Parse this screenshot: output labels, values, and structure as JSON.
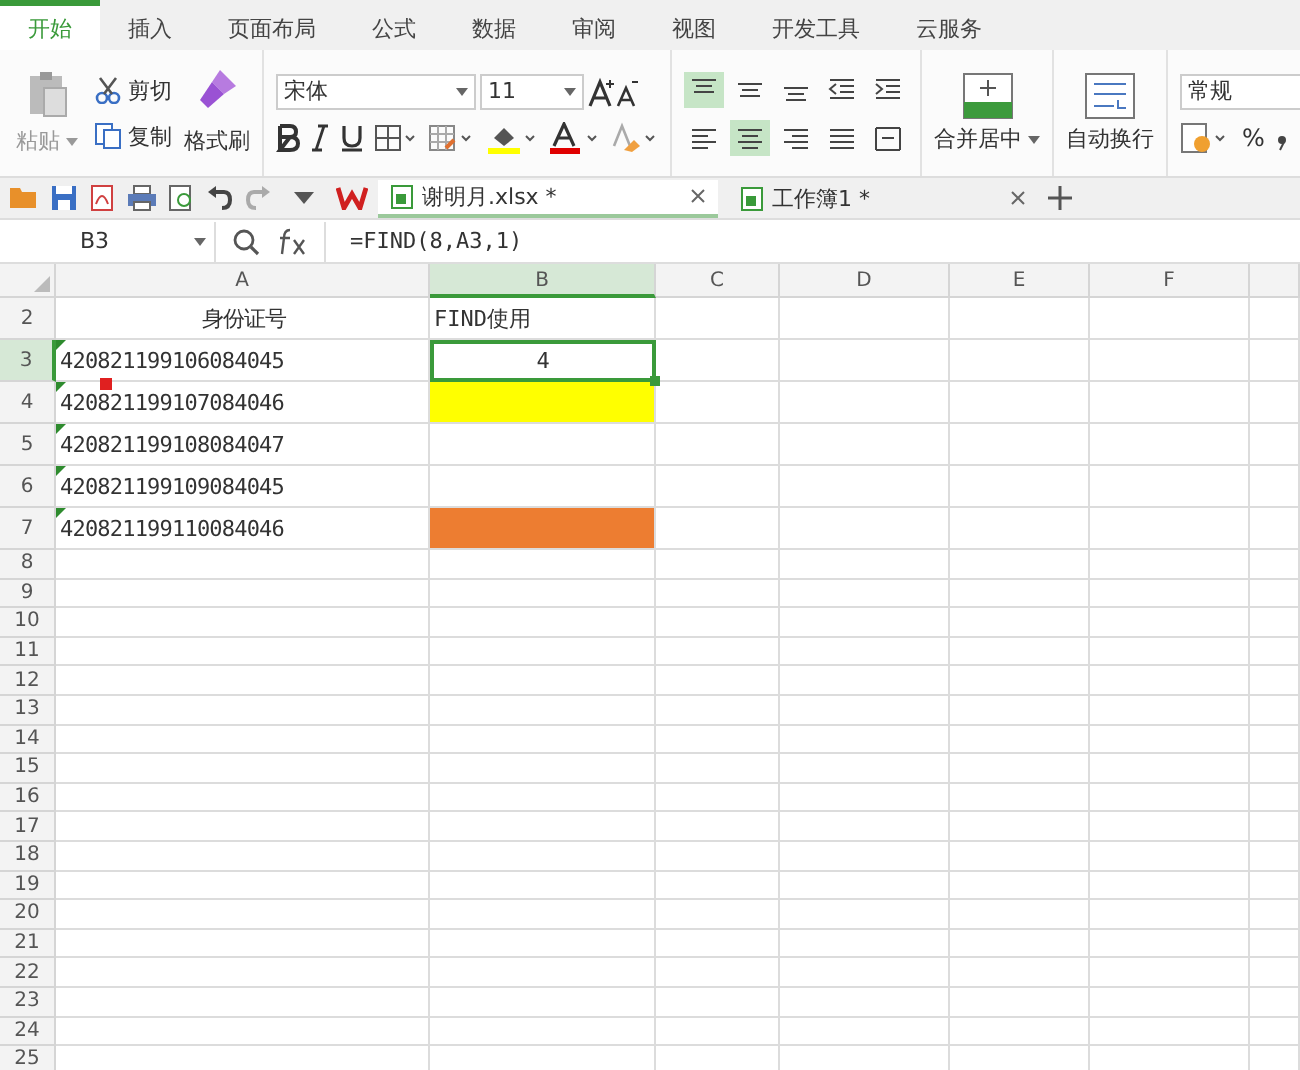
{
  "menu_tabs": [
    {
      "label": "开始",
      "selected": true
    },
    {
      "label": "插入",
      "selected": false
    },
    {
      "label": "页面布局",
      "selected": false
    },
    {
      "label": "公式",
      "selected": false
    },
    {
      "label": "数据",
      "selected": false
    },
    {
      "label": "审阅",
      "selected": false
    },
    {
      "label": "视图",
      "selected": false
    },
    {
      "label": "开发工具",
      "selected": false
    },
    {
      "label": "云服务",
      "selected": false
    }
  ],
  "clipboard": {
    "paste": "粘贴",
    "cut": "剪切",
    "copy": "复制",
    "format_painter": "格式刷"
  },
  "font": {
    "family": "宋体",
    "size": "11"
  },
  "align_top_selected": true,
  "align_center_selected": true,
  "merge": "合并居中",
  "wrap": "自动换行",
  "number_format": "常规",
  "percent": "%",
  "doc_tabs": [
    {
      "label": "谢明月.xlsx *",
      "selected": true
    },
    {
      "label": "工作簿1 *",
      "selected": false
    }
  ],
  "name_box": "B3",
  "formula": "=FIND(8,A3,1)",
  "columns": [
    {
      "label": "A",
      "selected": false
    },
    {
      "label": "B",
      "selected": true
    },
    {
      "label": "C",
      "selected": false
    },
    {
      "label": "D",
      "selected": false
    },
    {
      "label": "E",
      "selected": false
    },
    {
      "label": "F",
      "selected": false
    }
  ],
  "rows": [
    {
      "number": "2",
      "selected": false,
      "a": "身份证号",
      "b": "FIND使用"
    },
    {
      "number": "3",
      "selected": true,
      "a": "420821199106084045",
      "a_warning": true,
      "a_mark": true,
      "b": "4",
      "b_active": true
    },
    {
      "number": "4",
      "selected": false,
      "a": "420821199107084046",
      "a_warning": true,
      "highlight": {
        "color": "#ffff00"
      }
    },
    {
      "number": "5",
      "selected": false,
      "a": "420821199108084047",
      "a_warning": true
    },
    {
      "number": "6",
      "selected": false,
      "a": "420821199109084045",
      "a_warning": true
    },
    {
      "number": "7",
      "selected": false,
      "a": "420821199110084046",
      "a_warning": true,
      "highlight": {
        "color": "#ed7d31"
      }
    },
    {
      "number": "8",
      "selected": false
    },
    {
      "number": "9",
      "selected": false
    },
    {
      "number": "10",
      "selected": false
    },
    {
      "number": "11",
      "selected": false
    },
    {
      "number": "12",
      "selected": false
    },
    {
      "number": "13",
      "selected": false
    },
    {
      "number": "14",
      "selected": false
    },
    {
      "number": "15",
      "selected": false
    },
    {
      "number": "16",
      "selected": false
    },
    {
      "number": "17",
      "selected": false
    },
    {
      "number": "18",
      "selected": false
    },
    {
      "number": "19",
      "selected": false
    },
    {
      "number": "20",
      "selected": false
    },
    {
      "number": "21",
      "selected": false
    },
    {
      "number": "22",
      "selected": false
    },
    {
      "number": "23",
      "selected": false
    },
    {
      "number": "24",
      "selected": false
    },
    {
      "number": "25",
      "selected": false
    }
  ]
}
